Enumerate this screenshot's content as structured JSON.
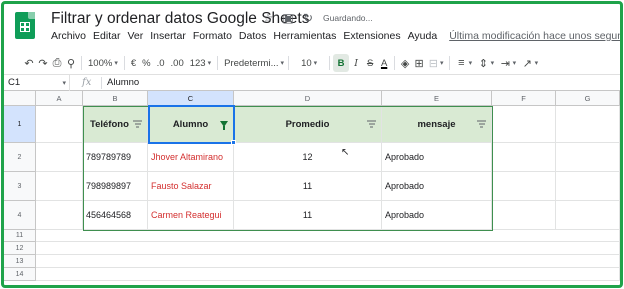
{
  "app": {
    "title": "Filtrar y ordenar datos Google Sheets",
    "saving_status": "Guardando...",
    "last_edit": "Última modificación hace unos segundos"
  },
  "menu": [
    "Archivo",
    "Editar",
    "Ver",
    "Insertar",
    "Formato",
    "Datos",
    "Herramientas",
    "Extensiones",
    "Ayuda"
  ],
  "toolbar": {
    "zoom": "100%",
    "currency": "€",
    "percent": "%",
    "decrease_decimals": ".0",
    "increase_decimals": ".00",
    "more_formats": "123",
    "font": "Predetermi...",
    "font_size": "10",
    "bold": "B",
    "italic": "I",
    "strike": "S",
    "text_color": "A"
  },
  "formula_bar": {
    "cell_ref": "C1",
    "fx": "fx",
    "value": "Alumno"
  },
  "columns": [
    "A",
    "B",
    "C",
    "D",
    "E",
    "F",
    "G"
  ],
  "rows": [
    "1",
    "2",
    "3",
    "4",
    "11",
    "12",
    "13",
    "14"
  ],
  "table": {
    "headers": [
      "Teléfono",
      "Alumno",
      "Promedio",
      "mensaje"
    ],
    "data": [
      [
        "789789789",
        "Jhover Altamirano",
        "12",
        "Aprobado"
      ],
      [
        "798989897",
        "Fausto Salazar",
        "11",
        "Aprobado"
      ],
      [
        "456464568",
        "Carmen Reategui",
        "11",
        "Aprobado"
      ]
    ]
  },
  "colors": {
    "accent": "#1fa34a",
    "header_fill": "#d9ead3",
    "name_text": "#d32f2f",
    "selection": "#1a73e8"
  }
}
